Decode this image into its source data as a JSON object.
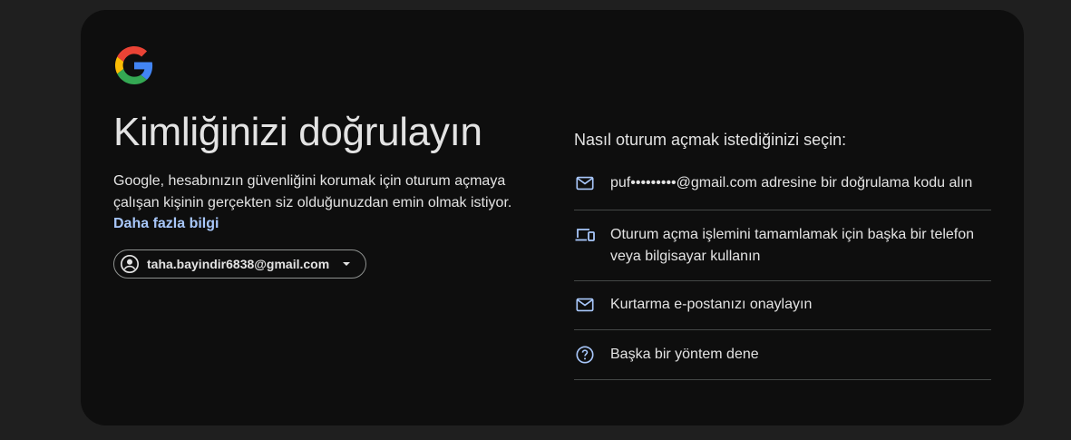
{
  "brand": {
    "logo_icon": "google-g-logo",
    "colors": [
      "#4285F4",
      "#EA4335",
      "#FBBC05",
      "#34A853"
    ]
  },
  "left": {
    "title": "Kimliğinizi doğrulayın",
    "description": "Google, hesabınızın güvenliğini korumak için oturum açmaya çalışan kişinin gerçekten siz olduğunuzdan emin olmak istiyor.",
    "learn_more": "Daha fazla bilgi",
    "account_email": "taha.bayindir6838@gmail.com"
  },
  "right": {
    "heading": "Nasıl oturum açmak istediğinizi seçin:",
    "options": [
      {
        "icon": "mail-icon",
        "label": "puf•••••••••@gmail.com adresine bir doğrulama kodu alın"
      },
      {
        "icon": "devices-icon",
        "label": "Oturum açma işlemini tamamlamak için başka bir telefon veya bilgisayar kullanın"
      },
      {
        "icon": "mail-icon",
        "label": "Kurtarma e-postanızı onaylayın"
      },
      {
        "icon": "help-circle-icon",
        "label": "Başka bir yöntem dene"
      }
    ]
  },
  "colors": {
    "accent": "#a8c7fa",
    "icon": "#a8c7fa",
    "background": "#1f1f1f",
    "card": "#0e0e0e"
  }
}
